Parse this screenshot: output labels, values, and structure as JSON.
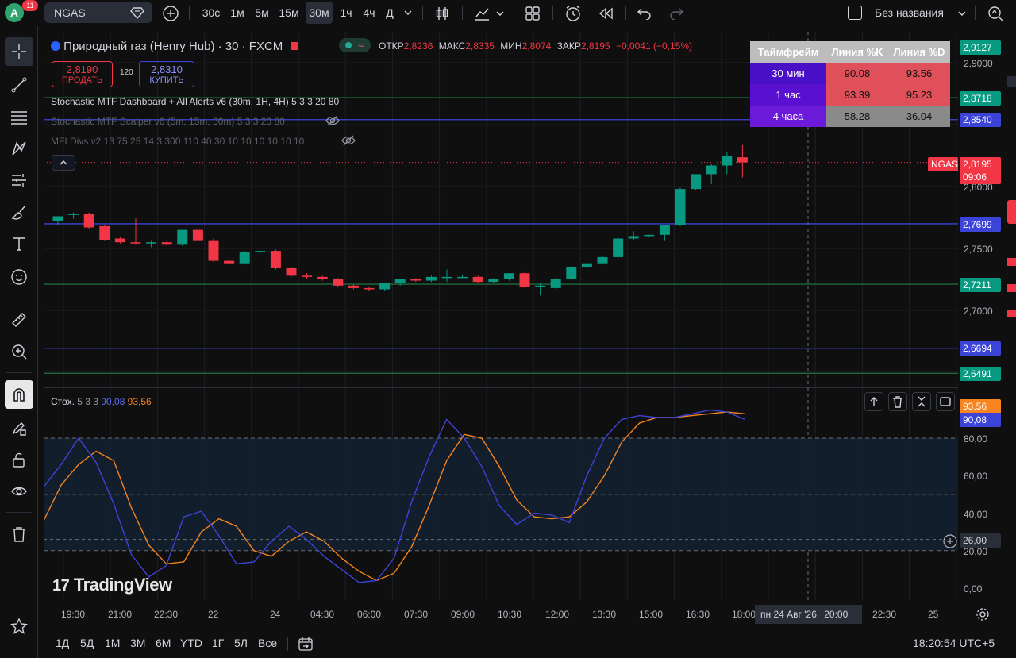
{
  "toolbar": {
    "avatar_letter": "A",
    "notifications": "11",
    "symbol": "NGAS",
    "intervals": [
      "30с",
      "1м",
      "5м",
      "15м",
      "30м",
      "1ч",
      "4ч",
      "Д"
    ],
    "active_interval": "30м",
    "layout_name": "Без названия"
  },
  "legend": {
    "title": "Природный газ (Henry Hub) · 30 · FXCM",
    "open_label": "ОТКР",
    "open": "2,8236",
    "high_label": "МАКС",
    "high": "2,8335",
    "low_label": "МИН",
    "low": "2,8074",
    "close_label": "ЗАКР",
    "close": "2,8195",
    "change": "−0,0041 (−0,15%)",
    "sell_price": "2,8190",
    "sell_label": "ПРОДАТЬ",
    "spread": "120",
    "buy_price": "2,8310",
    "buy_label": "КУПИТЬ",
    "indicator1": "Stochastic MTF Dashboard + All Alerts v6 (30m, 1H, 4H) 5 3 3 20 80",
    "indicator2": "Stochastic MTF Scalper v6 (5m, 15m, 30m) 5 3 3 20 80",
    "indicator3": "MFI Divs v2 13 75 25 14 3 300 110 40 30 10 10 10 10 10 10"
  },
  "dashboard": {
    "headers": [
      "Таймфрейм",
      "Линия %K",
      "Линия %D"
    ],
    "rows": [
      {
        "tf": "30 мин",
        "k": "90.08",
        "d": "93.56"
      },
      {
        "tf": "1 час",
        "k": "93.39",
        "d": "95.23"
      },
      {
        "tf": "4 часа",
        "k": "58.28",
        "d": "36.04"
      }
    ]
  },
  "price_axis": {
    "labels": [
      "2,9000",
      "2,8000",
      "2,7500",
      "2,7000"
    ],
    "badges": [
      {
        "value": "2,9127",
        "color": "#089981"
      },
      {
        "value": "2,8718",
        "color": "#089981"
      },
      {
        "value": "2,8540",
        "color": "#3c44d8"
      },
      {
        "value": "2,7699",
        "color": "#3c44d8"
      },
      {
        "value": "2,7211",
        "color": "#089981"
      },
      {
        "value": "2,6694",
        "color": "#3c44d8"
      },
      {
        "value": "2,6491",
        "color": "#089981"
      }
    ],
    "last_symbol": "NGAS",
    "last_price": "2,8195",
    "countdown": "09:06"
  },
  "stoch": {
    "legend_name": "Стох.",
    "legend_params": "5 3 3",
    "k_value": "90,08",
    "d_value": "93,56",
    "axis_labels": [
      "80,00",
      "60,00",
      "40,00",
      "20,00",
      "0,00"
    ],
    "cursor_value": "26,00",
    "k_color": "#3c44d8",
    "d_color": "#f7841e"
  },
  "time_axis": {
    "labels": [
      "19:30",
      "21:00",
      "22:30",
      "22",
      "24",
      "04:30",
      "06:00",
      "07:30",
      "09:00",
      "10:30",
      "12:00",
      "13:30",
      "15:00",
      "16:30",
      "18:00",
      "22:30",
      "25"
    ],
    "crosshair_date": "пн 24 Авг '26",
    "crosshair_time": "20:00"
  },
  "bottom": {
    "ranges": [
      "1Д",
      "5Д",
      "1М",
      "3М",
      "6М",
      "YTD",
      "1Г",
      "5Л",
      "Все"
    ],
    "clock": "18:20:54 UTC+5"
  },
  "watermark": "TradingView",
  "chart_data": {
    "type": "candlestick",
    "price_range": [
      2.64,
      2.92
    ],
    "candles": [
      {
        "o": 2.772,
        "h": 2.776,
        "l": 2.769,
        "c": 2.776
      },
      {
        "o": 2.777,
        "h": 2.779,
        "l": 2.774,
        "c": 2.778
      },
      {
        "o": 2.778,
        "h": 2.779,
        "l": 2.766,
        "c": 2.767
      },
      {
        "o": 2.768,
        "h": 2.769,
        "l": 2.756,
        "c": 2.757
      },
      {
        "o": 2.758,
        "h": 2.759,
        "l": 2.754,
        "c": 2.755
      },
      {
        "o": 2.755,
        "h": 2.774,
        "l": 2.753,
        "c": 2.754
      },
      {
        "o": 2.754,
        "h": 2.756,
        "l": 2.751,
        "c": 2.755
      },
      {
        "o": 2.755,
        "h": 2.756,
        "l": 2.752,
        "c": 2.753
      },
      {
        "o": 2.753,
        "h": 2.765,
        "l": 2.752,
        "c": 2.765
      },
      {
        "o": 2.765,
        "h": 2.766,
        "l": 2.756,
        "c": 2.756
      },
      {
        "o": 2.756,
        "h": 2.758,
        "l": 2.739,
        "c": 2.74
      },
      {
        "o": 2.74,
        "h": 2.742,
        "l": 2.737,
        "c": 2.738
      },
      {
        "o": 2.738,
        "h": 2.748,
        "l": 2.737,
        "c": 2.747
      },
      {
        "o": 2.747,
        "h": 2.748,
        "l": 2.746,
        "c": 2.748
      },
      {
        "o": 2.748,
        "h": 2.749,
        "l": 2.733,
        "c": 2.734
      },
      {
        "o": 2.734,
        "h": 2.735,
        "l": 2.727,
        "c": 2.728
      },
      {
        "o": 2.728,
        "h": 2.73,
        "l": 2.725,
        "c": 2.727
      },
      {
        "o": 2.727,
        "h": 2.728,
        "l": 2.724,
        "c": 2.725
      },
      {
        "o": 2.725,
        "h": 2.726,
        "l": 2.719,
        "c": 2.72
      },
      {
        "o": 2.72,
        "h": 2.721,
        "l": 2.717,
        "c": 2.718
      },
      {
        "o": 2.718,
        "h": 2.719,
        "l": 2.716,
        "c": 2.717
      },
      {
        "o": 2.717,
        "h": 2.722,
        "l": 2.716,
        "c": 2.722
      },
      {
        "o": 2.722,
        "h": 2.725,
        "l": 2.72,
        "c": 2.725
      },
      {
        "o": 2.725,
        "h": 2.726,
        "l": 2.723,
        "c": 2.724
      },
      {
        "o": 2.724,
        "h": 2.728,
        "l": 2.723,
        "c": 2.727
      },
      {
        "o": 2.727,
        "h": 2.733,
        "l": 2.723,
        "c": 2.727
      },
      {
        "o": 2.727,
        "h": 2.729,
        "l": 2.726,
        "c": 2.727
      },
      {
        "o": 2.727,
        "h": 2.728,
        "l": 2.722,
        "c": 2.723
      },
      {
        "o": 2.723,
        "h": 2.726,
        "l": 2.722,
        "c": 2.725
      },
      {
        "o": 2.725,
        "h": 2.73,
        "l": 2.724,
        "c": 2.73
      },
      {
        "o": 2.73,
        "h": 2.731,
        "l": 2.718,
        "c": 2.719
      },
      {
        "o": 2.719,
        "h": 2.722,
        "l": 2.712,
        "c": 2.72
      },
      {
        "o": 2.718,
        "h": 2.727,
        "l": 2.717,
        "c": 2.725
      },
      {
        "o": 2.725,
        "h": 2.736,
        "l": 2.724,
        "c": 2.735
      },
      {
        "o": 2.735,
        "h": 2.739,
        "l": 2.734,
        "c": 2.738
      },
      {
        "o": 2.738,
        "h": 2.744,
        "l": 2.737,
        "c": 2.743
      },
      {
        "o": 2.743,
        "h": 2.759,
        "l": 2.742,
        "c": 2.758
      },
      {
        "o": 2.758,
        "h": 2.764,
        "l": 2.757,
        "c": 2.76
      },
      {
        "o": 2.76,
        "h": 2.761,
        "l": 2.759,
        "c": 2.761
      },
      {
        "o": 2.761,
        "h": 2.768,
        "l": 2.756,
        "c": 2.769
      },
      {
        "o": 2.769,
        "h": 2.799,
        "l": 2.768,
        "c": 2.798
      },
      {
        "o": 2.798,
        "h": 2.81,
        "l": 2.797,
        "c": 2.81
      },
      {
        "o": 2.81,
        "h": 2.818,
        "l": 2.802,
        "c": 2.817
      },
      {
        "o": 2.817,
        "h": 2.828,
        "l": 2.81,
        "c": 2.825
      },
      {
        "o": 2.8236,
        "h": 2.8335,
        "l": 2.8074,
        "c": 2.8195
      }
    ],
    "stochastic": {
      "range": [
        0,
        100
      ],
      "k": [
        54,
        66,
        80,
        67,
        45,
        18,
        6,
        12,
        38,
        41,
        28,
        13,
        14,
        25,
        33,
        26,
        17,
        10,
        3,
        4,
        16,
        46,
        70,
        90,
        80,
        65,
        44,
        34,
        40,
        39,
        35,
        60,
        80,
        90,
        92,
        91,
        91,
        93,
        95,
        94,
        90
      ],
      "d": [
        36,
        55,
        66,
        73,
        68,
        43,
        23,
        13,
        14,
        30,
        37,
        33,
        20,
        17,
        25,
        30,
        25,
        16,
        9,
        4,
        8,
        22,
        44,
        68,
        82,
        80,
        65,
        47,
        38,
        37,
        38,
        46,
        60,
        78,
        88,
        91,
        91,
        92,
        93,
        94,
        93
      ]
    },
    "levels": [
      80,
      50,
      20
    ]
  }
}
